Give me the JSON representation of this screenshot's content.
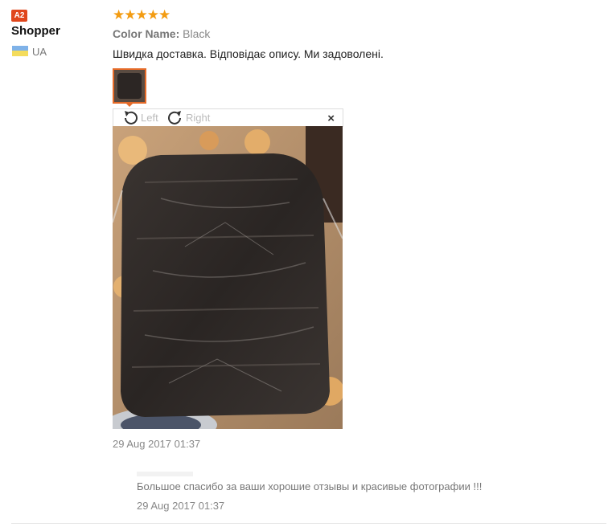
{
  "reviewer": {
    "level_badge": "A2",
    "name": "Shopper",
    "country": "UA"
  },
  "review": {
    "rating": 5,
    "stars": "★★★★★",
    "color_label": "Color Name:",
    "color_value": "Black",
    "text": "Швидка доставка. Відповідає опису. Ми задоволені.",
    "date": "29 Aug 2017 01:37"
  },
  "viewer": {
    "rotate_left_label": "Left",
    "rotate_right_label": "Right",
    "close_symbol": "×"
  },
  "reply": {
    "text": "Большое спасибо за ваши хорошие отзывы и красивые фотографии !!!",
    "date": "29 Aug 2017 01:37"
  },
  "colors": {
    "accent": "#e56a28",
    "badge": "#e0461c",
    "stars": "#f39c12"
  }
}
